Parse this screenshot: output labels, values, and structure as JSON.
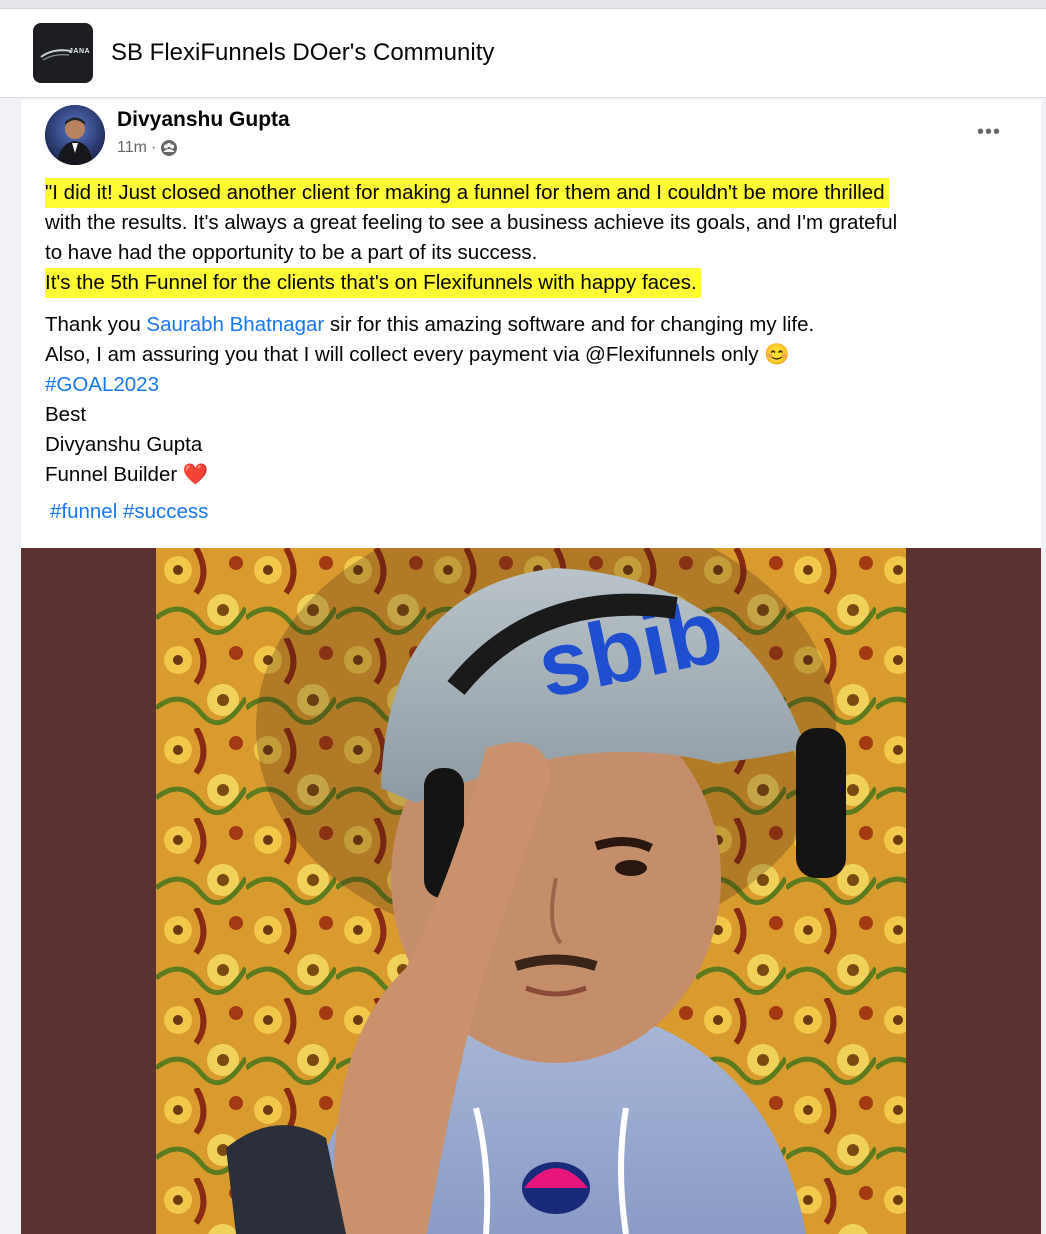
{
  "group": {
    "name": "SB FlexiFunnels DOer's Community",
    "logo_text": "JANA"
  },
  "post": {
    "author": "Divyanshu Gupta",
    "time": "11m",
    "audience_icon": "group-audience-icon",
    "more_label": "•••",
    "lines": {
      "l1": "\"I did it! Just closed another client for making a funnel for them and I couldn't be more thrilled",
      "l2": "with the results. It's always a great feeling to see a business achieve its goals, and I'm grateful",
      "l3": "to have had the opportunity to be a part of its success.",
      "l4": "It's the 5th Funnel for the clients that's on Flexifunnels with happy faces.",
      "l5_pre": "Thank you ",
      "l5_mention": "Saurabh Bhatnagar",
      "l5_post": " sir for this amazing software and for changing my life.",
      "l6": "Also, I am assuring you that I will collect every payment via @Flexifunnels only",
      "l6_emoji": "😊",
      "l7": "#GOAL2023",
      "l8": "Best",
      "l9": "Divyanshu Gupta",
      "l10": "Funnel Builder",
      "l10_emoji": "❤️"
    },
    "hashtags": [
      "#funnel",
      "#success"
    ]
  },
  "colors": {
    "highlight": "#fffc36",
    "link": "#1877f2",
    "photo_background": "#5b3131"
  }
}
